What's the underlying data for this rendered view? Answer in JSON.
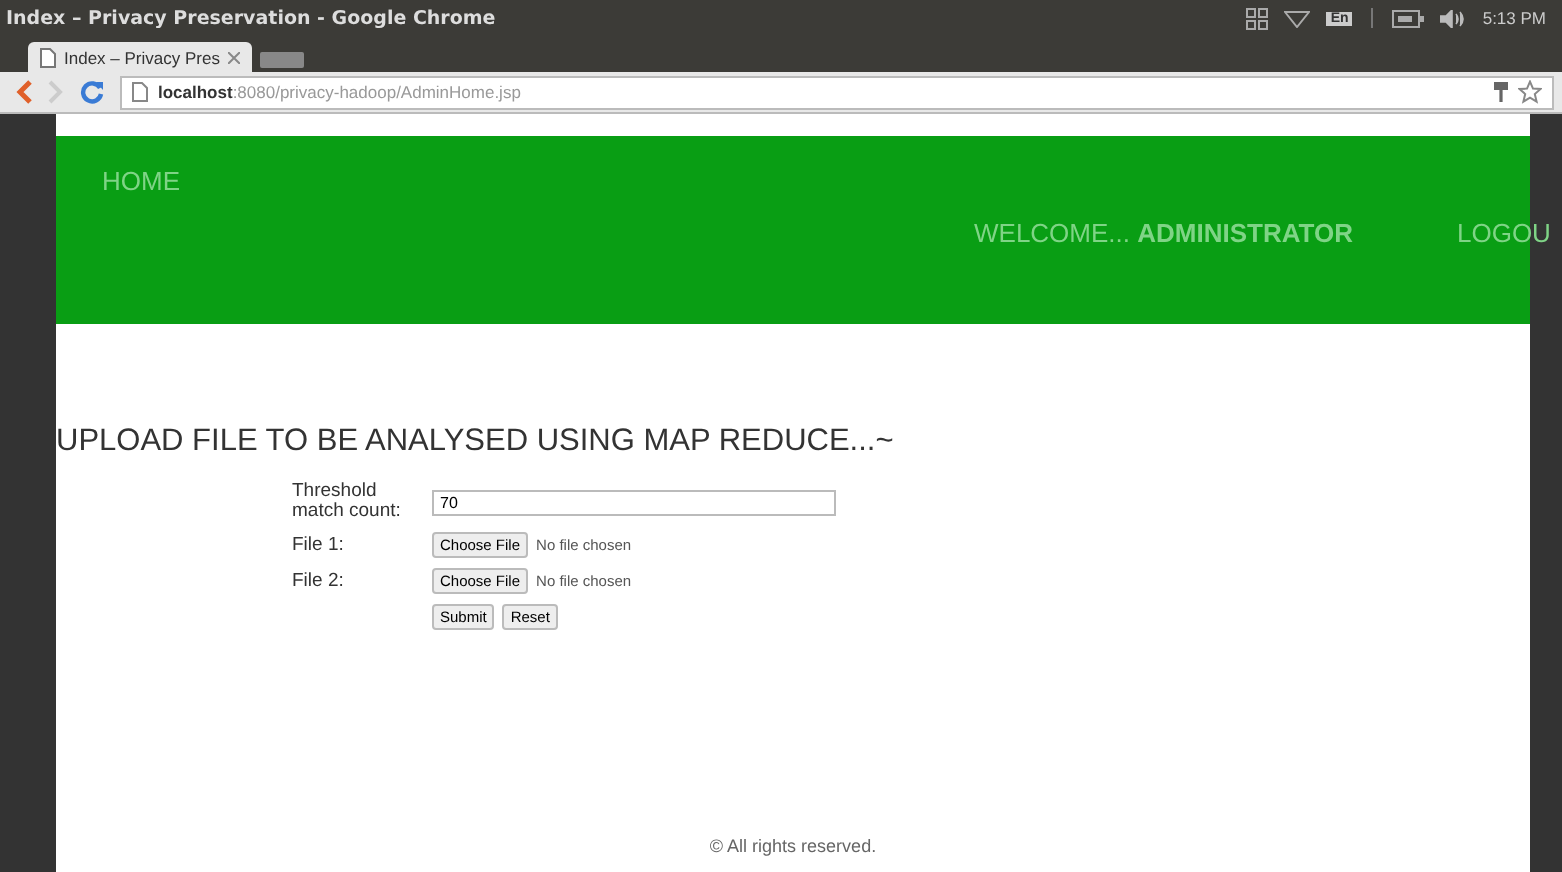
{
  "window": {
    "title": "Index – Privacy Preservation - Google Chrome"
  },
  "tray": {
    "keyboard": "En",
    "time": "5:13 PM"
  },
  "tabs": [
    {
      "label": "Index – Privacy Pres",
      "selected": true
    }
  ],
  "address_bar": {
    "host": "localhost",
    "rest": ":8080/privacy-hadoop/AdminHome.jsp"
  },
  "nav": {
    "home": "HOME",
    "welcome": "WELCOME...",
    "user": "ADMINISTRATOR",
    "logout": "LOGOU"
  },
  "heading": "UPLOAD FILE TO BE ANALYSED USING MAP REDUCE...~",
  "form": {
    "threshold_label": "Threshold match count:",
    "threshold_value": "70",
    "files": [
      {
        "label": "File 1:",
        "button": "Choose File",
        "status": "No file chosen"
      },
      {
        "label": "File 2:",
        "button": "Choose File",
        "status": "No file chosen"
      }
    ],
    "buttons": [
      "Submit",
      "Reset"
    ]
  },
  "footer": "© All rights reserved."
}
